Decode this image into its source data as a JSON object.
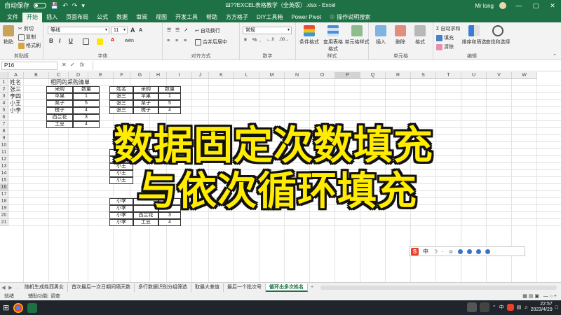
{
  "window": {
    "title": "Ш??EXCEL表格教学（全英版）.xlsx - Excel",
    "user": "Mr long",
    "autosave_label": "自动保存",
    "minimize": "—",
    "restore": "▢",
    "close": "✕",
    "qat_icons": [
      "save-icon",
      "undo-icon",
      "redo-icon"
    ]
  },
  "ribbon_tabs": [
    "文件",
    "开始",
    "插入",
    "页面布局",
    "公式",
    "数据",
    "审阅",
    "视图",
    "开发工具",
    "帮助",
    "方方格子",
    "DIY工具箱",
    "Power Pivot"
  ],
  "active_tab": "开始",
  "tell_me": "操作说明搜索",
  "ribbon": {
    "clipboard": {
      "label": "剪贴板",
      "paste": "粘贴",
      "cut": "剪切",
      "copy": "复制",
      "painter": "格式刷"
    },
    "font": {
      "label": "字体",
      "name": "等线",
      "size": "11",
      "grow": "A",
      "shrink": "A",
      "bold": "B",
      "italic": "I",
      "underline": "U",
      "wen": "wén"
    },
    "align": {
      "label": "对齐方式",
      "wrap": "自动换行",
      "merge": "合并后居中"
    },
    "number": {
      "label": "数字",
      "format": "常规",
      "percent": "%",
      "comma": ",",
      "dec_inc": "←.0",
      "dec_dec": ".00→"
    },
    "styles": {
      "label": "样式",
      "cond": "条件格式",
      "table": "套用表格格式",
      "cell": "单元格样式"
    },
    "cells": {
      "label": "单元格",
      "insert": "插入",
      "delete": "删除",
      "format": "格式"
    },
    "editing": {
      "label": "编辑",
      "autosum": "自动求和",
      "fill": "填充",
      "clear": "清除",
      "sort": "排序和筛选",
      "find": "查找和选择"
    }
  },
  "formula_bar": {
    "name_box": "P16",
    "cancel": "✕",
    "enter": "✓",
    "fx": "fx",
    "formula": ""
  },
  "columns": [
    "A",
    "B",
    "C",
    "D",
    "E",
    "F",
    "G",
    "H",
    "I",
    "J",
    "K",
    "L",
    "M",
    "N",
    "O",
    "P",
    "Q",
    "R",
    "S",
    "T",
    "U",
    "V",
    "W"
  ],
  "rows": [
    "1",
    "2",
    "3",
    "4",
    "5",
    "6",
    "7",
    "8",
    "9",
    "10",
    "11",
    "12",
    "13",
    "14",
    "15",
    "16",
    "17",
    "18",
    "19",
    "20",
    "21"
  ],
  "col_a": [
    "姓名",
    "张三",
    "李四",
    "小王",
    "小李"
  ],
  "table1": {
    "title": "相同的采购清单",
    "headers": [
      "采购",
      "数量"
    ],
    "rows": [
      [
        "苹果",
        "1"
      ],
      [
        "栗子",
        "5"
      ],
      [
        "梳子",
        "4"
      ],
      [
        "西兰花",
        "3"
      ],
      [
        "土豆",
        "4"
      ]
    ]
  },
  "table2": {
    "headers": [
      "姓名",
      "采购",
      "数量"
    ],
    "rows_top": [
      [
        "张三",
        "苹果",
        "1"
      ],
      [
        "张三",
        "栗子",
        "5"
      ],
      [
        "张三",
        "梳子",
        "4"
      ]
    ],
    "rows_mid_names": [
      "小王",
      "小王",
      "小王",
      "小王",
      "小王"
    ],
    "rows_mid_items": [
      "苹果"
    ],
    "rows_bottom": [
      [
        "小李",
        "",
        ""
      ],
      [
        "小李",
        "",
        ""
      ],
      [
        "小李",
        "西兰花",
        "3"
      ],
      [
        "小李",
        "土豆",
        "4"
      ]
    ]
  },
  "overlay": {
    "line1": "数据固定次数填充",
    "line2": "与依次循环填充"
  },
  "ime": {
    "logo": "S",
    "mode": "中"
  },
  "sheets": [
    "随机生成姓西男女",
    "首次最后一次日期间隔天数",
    "多行数据识别分组筛选",
    "取最大差值",
    "最后一个批次号",
    "循环出多次姓名"
  ],
  "active_sheet": "循环出多次姓名",
  "status": {
    "ready": "就绪",
    "accessibility": "辅助功能: 调查"
  },
  "taskbar": {
    "lang": "中",
    "time": "22:57",
    "date": "2023/4/29"
  },
  "colors": {
    "excel_green": "#1e7145",
    "overlay_yellow": "#ffec00"
  }
}
